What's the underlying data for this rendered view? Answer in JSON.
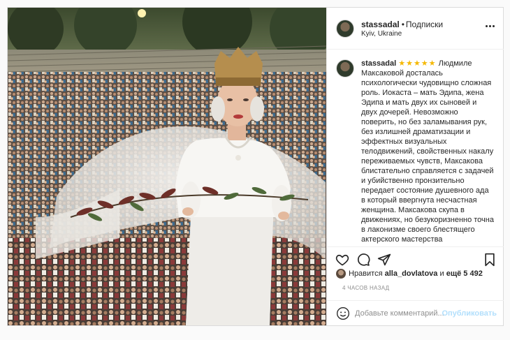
{
  "post": {
    "username": "stassadal",
    "separator": "•",
    "follow_status": "Подписки",
    "location": "Kyiv, Ukraine",
    "more_icon": "more-horizontal-icon"
  },
  "caption": {
    "username": "stassadal",
    "stars": "★★★★★",
    "text": "Людмиле Максаковой досталась психологически чудовищно сложная роль. Иокаста – мать Эдипа, жена Эдипа и мать двух их сыновей и двух дочерей. Невозможно поверить, но без заламывания рук, без излишней драматизации и эффектных визуальных телодвижений, свойственных накалу переживаемых чувств, Максакова блистательно справляется с задачей и убийственно пронзительно передает состояние душевного ада в который ввергнута несчастная женщина. Максакова скупа в движениях, но безукоризненно точна в лаконизме своего блестящего актерского мастерства"
  },
  "actions": {
    "like_icon": "heart-icon",
    "comment_icon": "comment-icon",
    "share_icon": "share-icon",
    "save_icon": "bookmark-icon"
  },
  "likes": {
    "prefix": "Нравится",
    "user": "alla_dovlatova",
    "middle": "и",
    "count": "ещё 5 492"
  },
  "timestamp": "4 ЧАСОВ НАЗАД",
  "comment_box": {
    "placeholder": "Добавьте комментарий...",
    "publish_label": "Опубликовать",
    "emoji_icon": "smile-icon"
  },
  "colors": {
    "accent": "#0095f6",
    "accent_disabled": "#b2dffc",
    "stars": "#f5b800",
    "border": "#dbdbdb"
  }
}
